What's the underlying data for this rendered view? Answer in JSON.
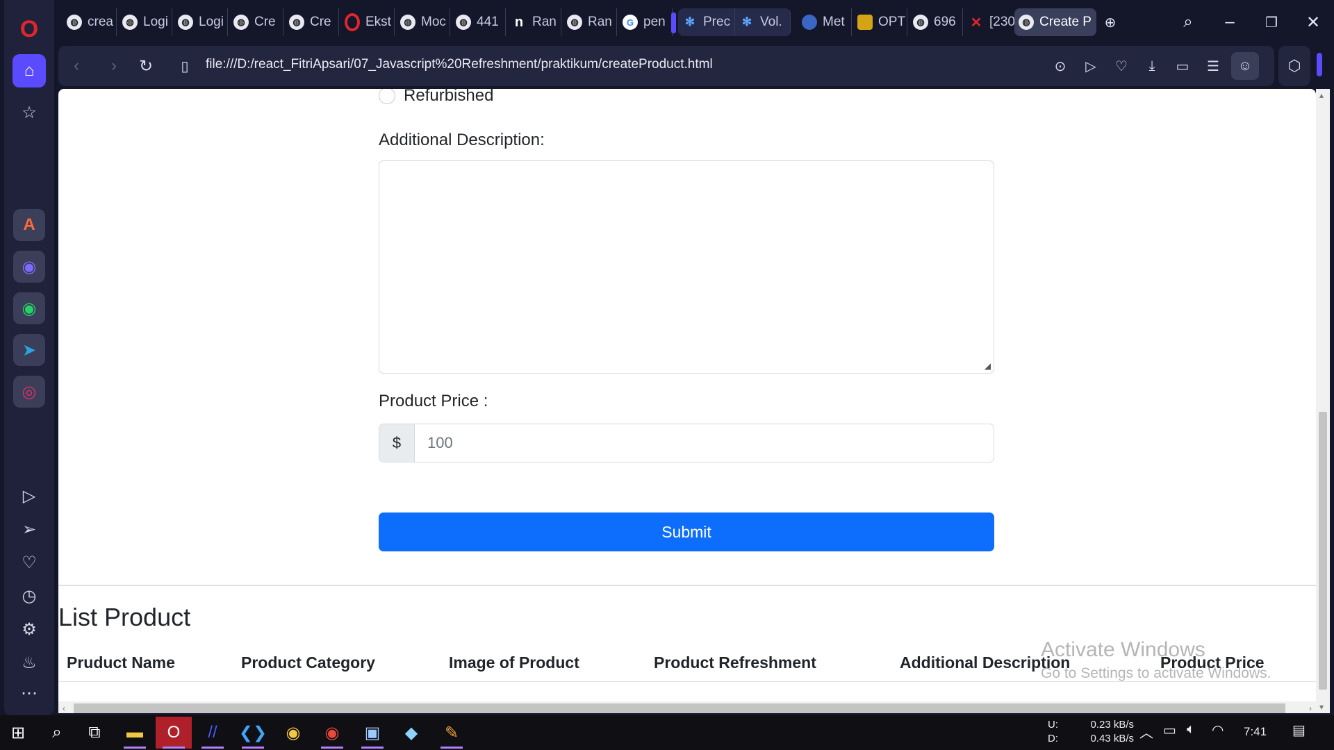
{
  "tabs": [
    {
      "label": "crea",
      "icon": "globe-icon"
    },
    {
      "label": "Logi",
      "icon": "globe-icon"
    },
    {
      "label": "Logi",
      "icon": "globe-icon"
    },
    {
      "label": "Cre",
      "icon": "globe-icon"
    },
    {
      "label": "Cre",
      "icon": "globe-icon"
    },
    {
      "label": "Ekst",
      "icon": "opera-icon"
    },
    {
      "label": "Moc",
      "icon": "globe-icon"
    },
    {
      "label": "441",
      "icon": "globe-icon"
    },
    {
      "label": "Ran",
      "icon": "notion-icon"
    },
    {
      "label": "Ran",
      "icon": "globe-icon"
    },
    {
      "label": "pen",
      "icon": "google-icon"
    },
    {
      "label": "Prec",
      "icon": "network-icon"
    },
    {
      "label": "Vol.",
      "icon": "network-icon"
    },
    {
      "label": "Met",
      "icon": "meta-icon"
    },
    {
      "label": "OPT",
      "icon": "badge-icon"
    },
    {
      "label": "696",
      "icon": "globe-icon"
    },
    {
      "label": "[230",
      "icon": "x-icon"
    },
    {
      "label": "Create P",
      "icon": "globe-icon"
    }
  ],
  "address_bar": {
    "url": "file:///D:/react_FitriApsari/07_Javascript%20Refreshment/praktikum/createProduct.html"
  },
  "form": {
    "radio_label": "Refurbished",
    "description_label": "Additional Description:",
    "description_value": "",
    "price_label": "Product Price :",
    "price_prefix": "$",
    "price_value": "100",
    "submit_label": "Submit"
  },
  "list": {
    "title": "List Product",
    "columns": [
      "Pruduct Name",
      "Product Category",
      "Image of Product",
      "Product Refreshment",
      "Additional Description",
      "Product Price"
    ]
  },
  "watermark": {
    "line1": "Activate Windows",
    "line2": "Go to Settings to activate Windows."
  },
  "taskbar": {
    "net_labels": [
      "U:",
      "D:"
    ],
    "net_values": [
      "0.23 kB/s",
      "0.43 kB/s"
    ],
    "time": "7:41"
  },
  "colors": {
    "accent": "#5b4bff",
    "submit": "#0d6efd",
    "browser_bg": "#14162a"
  }
}
